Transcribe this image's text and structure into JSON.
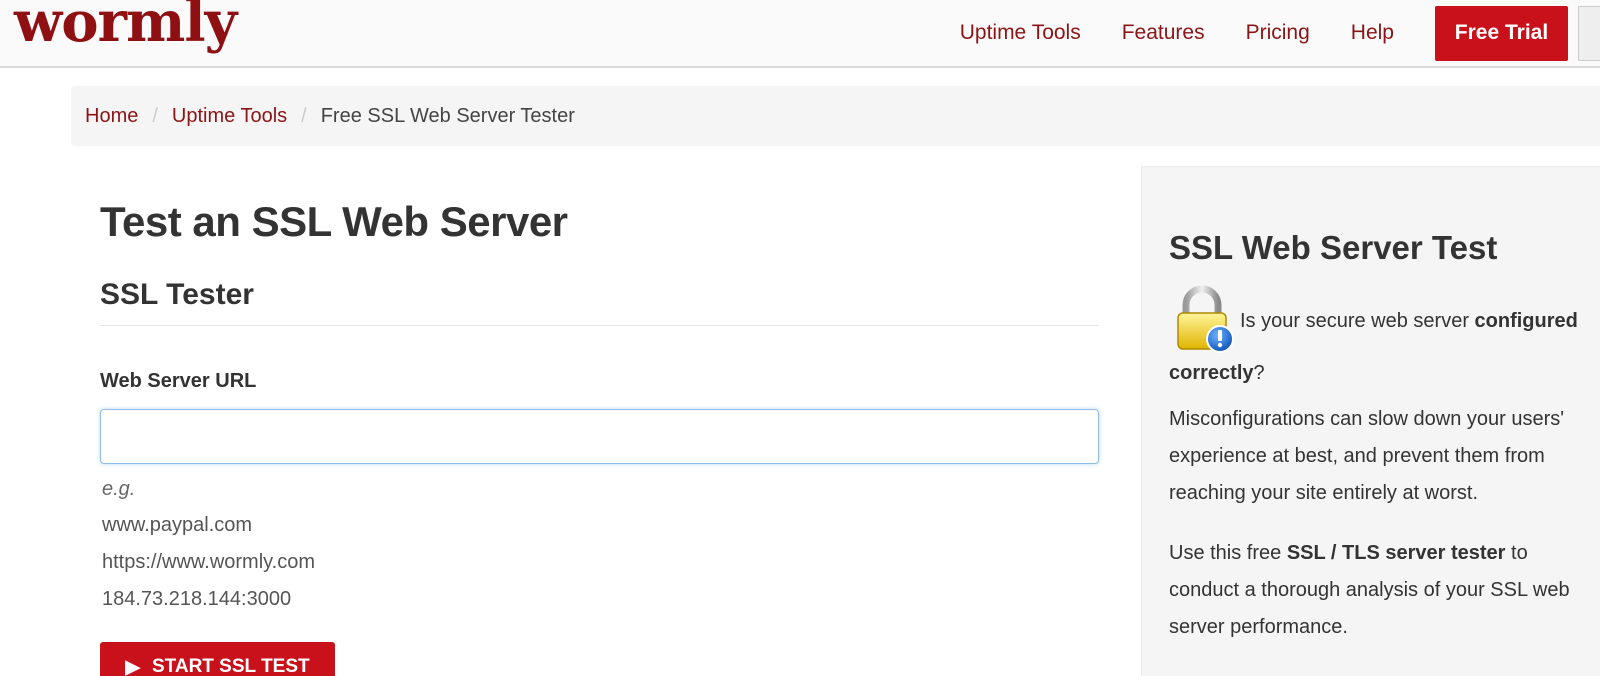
{
  "header": {
    "logo_text": "wormly",
    "nav": [
      "Uptime Tools",
      "Features",
      "Pricing",
      "Help"
    ],
    "cta_label": "Free Trial"
  },
  "breadcrumb": {
    "items": [
      "Home",
      "Uptime Tools"
    ],
    "current": "Free SSL Web Server Tester"
  },
  "main": {
    "title": "Test an SSL Web Server",
    "subtitle": "SSL Tester",
    "field_label": "Web Server URL",
    "input_value": "",
    "examples_label": "e.g.",
    "examples": [
      "www.paypal.com",
      "https://www.wormly.com",
      "184.73.218.144:3000"
    ],
    "start_button": "START SSL TEST"
  },
  "sidebar": {
    "title": "SSL Web Server Test",
    "p1_pre": "Is your secure web server ",
    "p1_bold": "configured correctly",
    "p1_post": "?",
    "p2": "Misconfigurations can slow down your users' experience at best, and prevent them from reaching your site entirely at worst.",
    "p3_pre": "Use this free ",
    "p3_bold": "SSL / TLS server tester",
    "p3_post": " to conduct a thorough analysis of your SSL web server performance."
  },
  "colors": {
    "brand": "#8b1416",
    "cta": "#c9111b"
  },
  "icons": [
    "padlock-warning-icon",
    "play-icon"
  ]
}
